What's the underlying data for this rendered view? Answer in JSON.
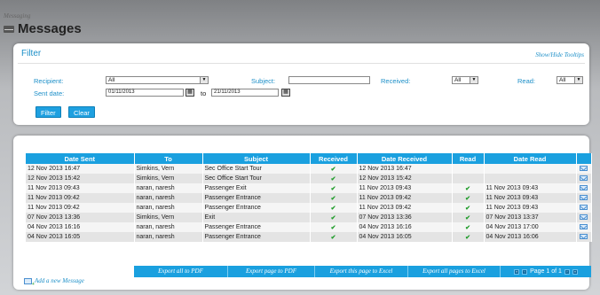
{
  "breadcrumb": "Messaging",
  "page_title": "Messages",
  "filter": {
    "title": "Filter",
    "tooltips_link": "Show/Hide Tooltips",
    "recipient_label": "Recipient:",
    "recipient_value": "All",
    "subject_label": "Subject:",
    "subject_value": "",
    "received_label": "Received:",
    "received_value": "All",
    "read_label": "Read:",
    "read_value": "All",
    "sent_date_label": "Sent date:",
    "sent_from": "01/11/2013",
    "to_label": "to",
    "sent_to": "21/11/2013",
    "filter_button": "Filter",
    "clear_button": "Clear"
  },
  "table": {
    "headers": [
      "Date Sent",
      "To",
      "Subject",
      "Received",
      "Date Received",
      "Read",
      "Date Read",
      ""
    ],
    "rows": [
      {
        "date_sent": "12 Nov 2013 16:47",
        "to": "Simkins, Vern",
        "subject": "Sec Office Start Tour",
        "received": "✔",
        "date_received": "12 Nov 2013 16:47",
        "read": "",
        "date_read": ""
      },
      {
        "date_sent": "12 Nov 2013 15:42",
        "to": "Simkins, Vern",
        "subject": "Sec Office Start Tour",
        "received": "✔",
        "date_received": "12 Nov 2013 15:42",
        "read": "",
        "date_read": ""
      },
      {
        "date_sent": "11 Nov 2013 09:43",
        "to": "naran, naresh",
        "subject": "Passenger Exit",
        "received": "✔",
        "date_received": "11 Nov 2013 09:43",
        "read": "✔",
        "date_read": "11 Nov 2013 09:43"
      },
      {
        "date_sent": "11 Nov 2013 09:42",
        "to": "naran, naresh",
        "subject": "Passenger Entrance",
        "received": "✔",
        "date_received": "11 Nov 2013 09:42",
        "read": "✔",
        "date_read": "11 Nov 2013 09:43"
      },
      {
        "date_sent": "11 Nov 2013 09:42",
        "to": "naran, naresh",
        "subject": "Passenger Entrance",
        "received": "✔",
        "date_received": "11 Nov 2013 09:42",
        "read": "✔",
        "date_read": "11 Nov 2013 09:43"
      },
      {
        "date_sent": "07 Nov 2013 13:36",
        "to": "Simkins, Vern",
        "subject": "Exit",
        "received": "✔",
        "date_received": "07 Nov 2013 13:36",
        "read": "✔",
        "date_read": "07 Nov 2013 13:37"
      },
      {
        "date_sent": "04 Nov 2013 16:16",
        "to": "naran, naresh",
        "subject": "Passenger Entrance",
        "received": "✔",
        "date_received": "04 Nov 2013 16:16",
        "read": "✔",
        "date_read": "04 Nov 2013 17:00"
      },
      {
        "date_sent": "04 Nov 2013 16:05",
        "to": "naran, naresh",
        "subject": "Passenger Entrance",
        "received": "✔",
        "date_received": "04 Nov 2013 16:05",
        "read": "✔",
        "date_read": "04 Nov 2013 16:06"
      }
    ]
  },
  "export": {
    "pdf_all": "Export all to PDF",
    "pdf_page": "Export page to PDF",
    "excel_page": "Export this page to Excel",
    "excel_all": "Export all pages to Excel",
    "page_text": "Page 1 of 1"
  },
  "add_message": "Add a new Message",
  "colors": {
    "accent": "#1aa0df",
    "check": "#1f9c2a"
  }
}
